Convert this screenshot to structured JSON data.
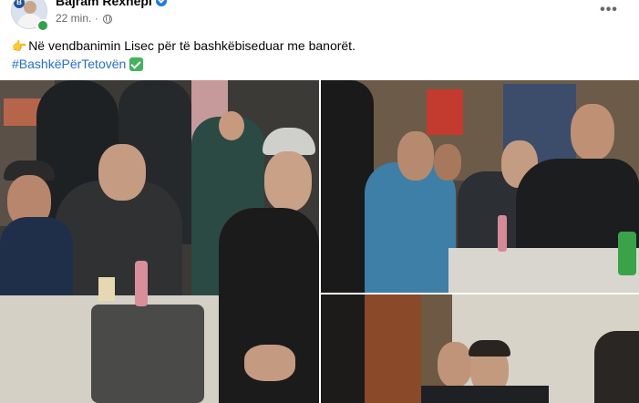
{
  "post": {
    "author": "Bajram Rexhepi",
    "avatar_badge": "B",
    "timestamp": "22 min.",
    "separator": "·",
    "audience_icon": "globe-icon",
    "more_label": "•••",
    "text_emoji": "👉",
    "text": "Në vendbanimin Lisec për të bashkëbiseduar me banorët.",
    "hashtag": "#BashkëPërTetovën"
  },
  "colors": {
    "hashtag": "#216fdb",
    "verified": "#1877f2",
    "meta": "#65676b",
    "online": "#31a24c",
    "check_emoji": "#43b35b"
  },
  "photos": [
    {
      "name": "photo-men-seated-table"
    },
    {
      "name": "photo-men-listening-right"
    },
    {
      "name": "photo-men-bottom"
    }
  ]
}
